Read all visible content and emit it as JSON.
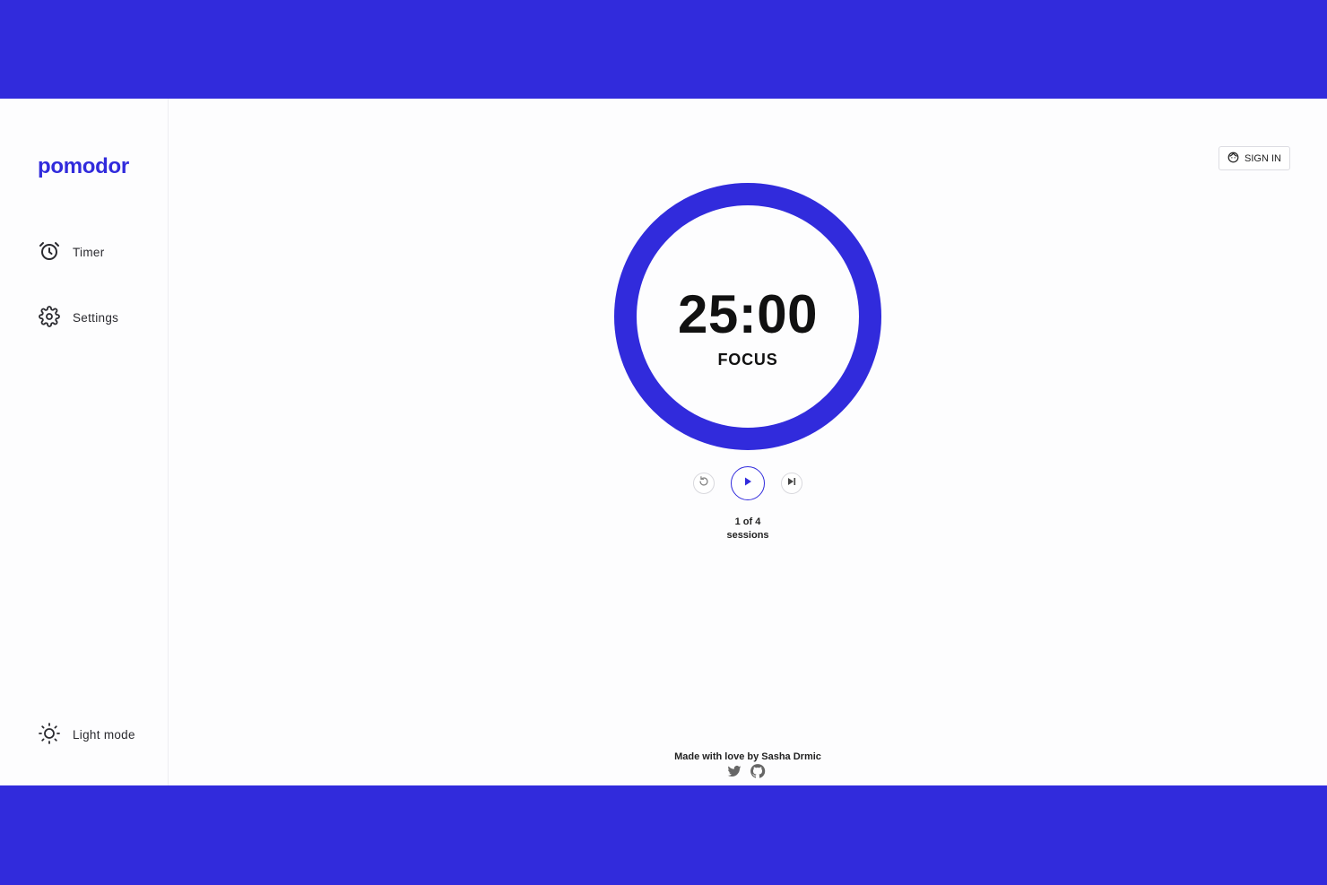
{
  "app": {
    "logo_text": "pomodor"
  },
  "sidebar": {
    "items": [
      {
        "label": "Timer",
        "icon": "alarm-clock-icon"
      },
      {
        "label": "Settings",
        "icon": "gear-icon"
      }
    ],
    "theme_toggle": {
      "label": "Light mode",
      "icon": "sun-icon"
    }
  },
  "header": {
    "signin_label": "SIGN IN",
    "signin_icon": "user-face-icon"
  },
  "timer": {
    "time": "25:00",
    "mode": "FOCUS",
    "progress": 1.0,
    "session_line1": "1 of 4",
    "session_line2": "sessions"
  },
  "controls": {
    "reset_icon": "reset-icon",
    "play_icon": "play-icon",
    "skip_icon": "skip-icon"
  },
  "footer": {
    "credit": "Made with love by Sasha Drmic",
    "links": [
      {
        "icon": "twitter-icon"
      },
      {
        "icon": "github-icon"
      }
    ]
  },
  "colors": {
    "accent": "#312bdc",
    "background": "#fdfdfe",
    "text": "#111111"
  }
}
